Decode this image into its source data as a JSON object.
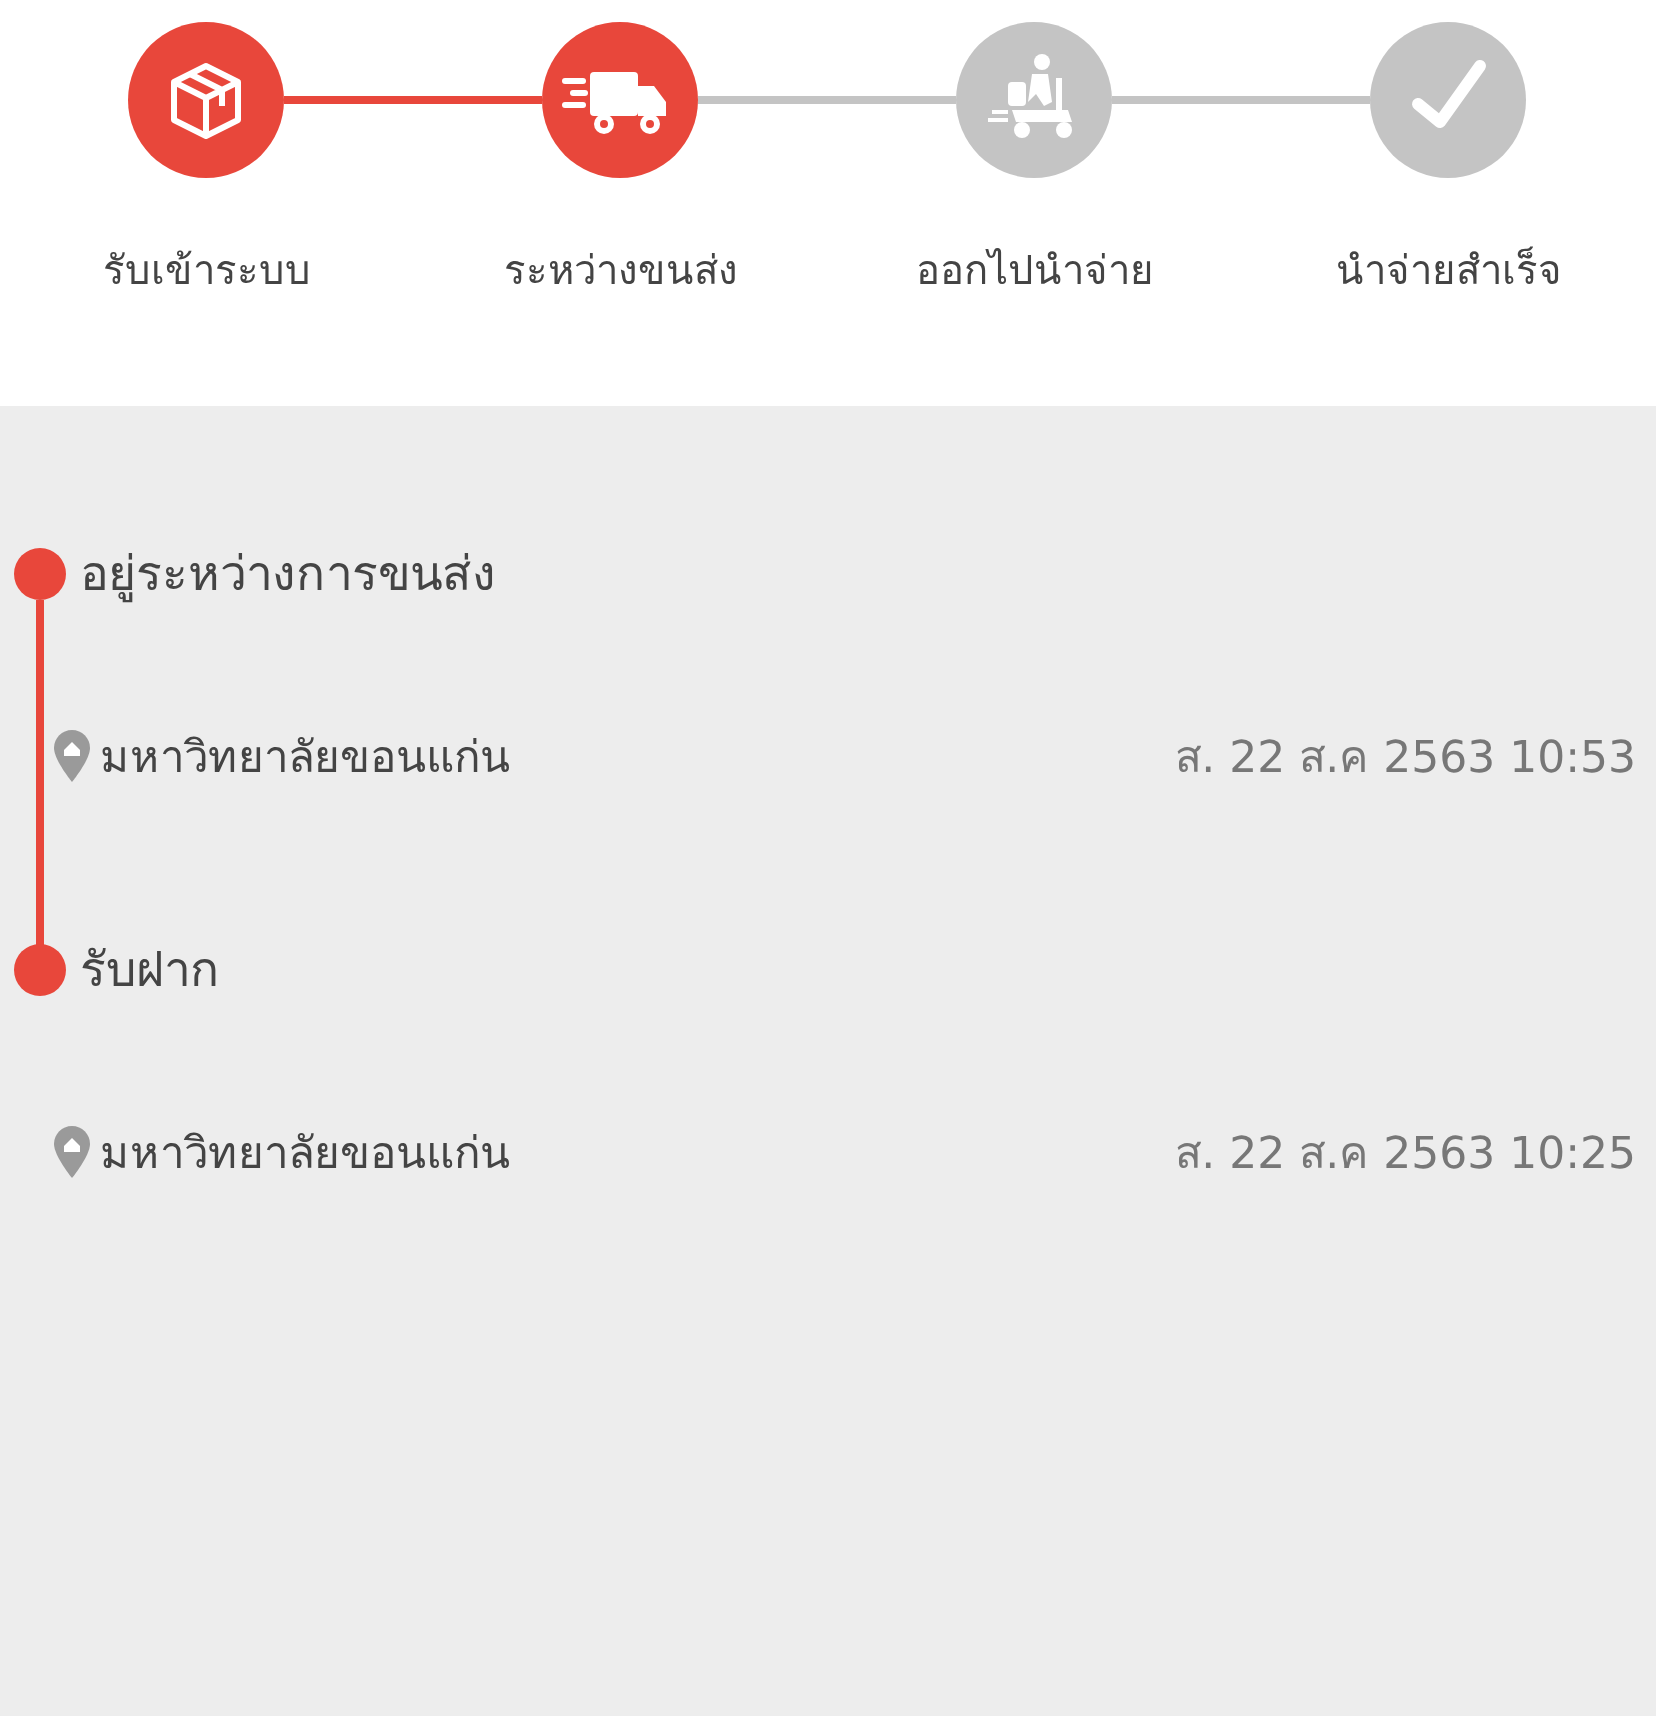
{
  "steps": [
    {
      "label": "รับเข้าระบบ",
      "kind": "box",
      "done": true
    },
    {
      "label": "ระหว่างขนส่ง",
      "kind": "truck",
      "done": true
    },
    {
      "label": "ออกไปนำจ่าย",
      "kind": "scooter",
      "done": false
    },
    {
      "label": "นำจ่ายสำเร็จ",
      "kind": "check",
      "done": false
    }
  ],
  "events": [
    {
      "title": "อยู่ระหว่างการขนส่ง",
      "location": "มหาวิทยาลัยขอนแก่น",
      "time": "ส. 22 ส.ค 2563 10:53"
    },
    {
      "title": "รับฝาก",
      "location": "มหาวิทยาลัยขอนแก่น",
      "time": "ส. 22 ส.ค 2563 10:25"
    }
  ]
}
